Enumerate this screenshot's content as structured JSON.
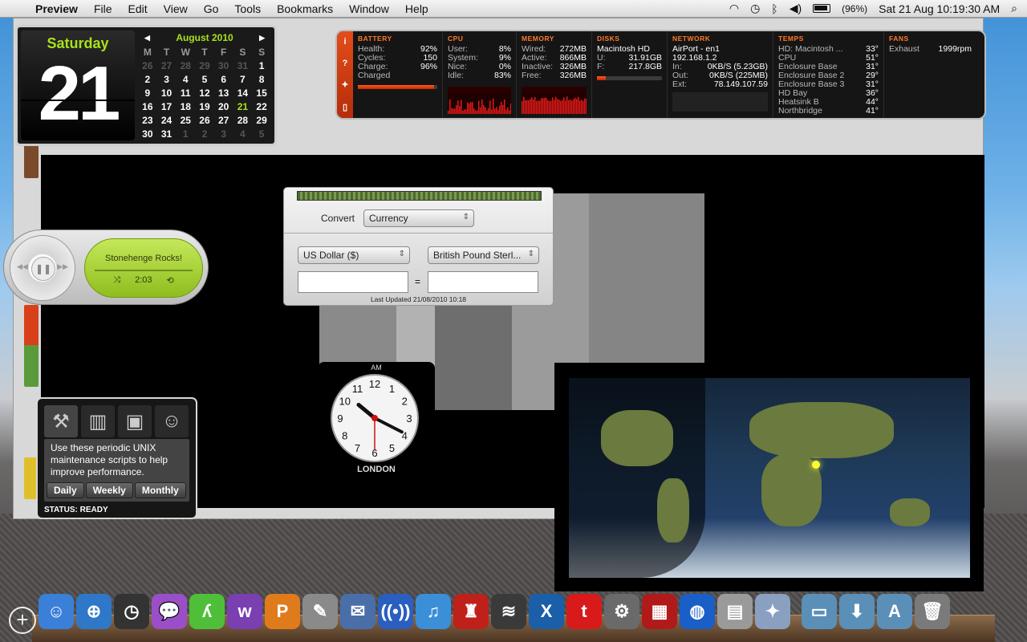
{
  "menubar": {
    "app_name": "Preview",
    "menus": [
      "File",
      "Edit",
      "View",
      "Go",
      "Tools",
      "Bookmarks",
      "Window",
      "Help"
    ],
    "battery_percent": "(96%)",
    "clock": "Sat 21 Aug  10:19:30 AM"
  },
  "calendar": {
    "weekday": "Saturday",
    "day": "21",
    "month_year": "August 2010",
    "weekday_headers": [
      "M",
      "T",
      "W",
      "T",
      "F",
      "S",
      "S"
    ],
    "weeks": [
      [
        "26",
        "27",
        "28",
        "29",
        "30",
        "31",
        "1"
      ],
      [
        "2",
        "3",
        "4",
        "5",
        "6",
        "7",
        "8"
      ],
      [
        "9",
        "10",
        "11",
        "12",
        "13",
        "14",
        "15"
      ],
      [
        "16",
        "17",
        "18",
        "19",
        "20",
        "21",
        "22"
      ],
      [
        "23",
        "24",
        "25",
        "26",
        "27",
        "28",
        "29"
      ],
      [
        "30",
        "31",
        "1",
        "2",
        "3",
        "4",
        "5"
      ]
    ]
  },
  "istat": {
    "battery": {
      "title": "BATTERY",
      "rows": [
        [
          "Health:",
          "92%"
        ],
        [
          "Cycles:",
          "150"
        ],
        [
          "Charge:",
          "96%"
        ],
        [
          "Charged",
          ""
        ]
      ],
      "charge_fraction": 0.96
    },
    "cpu": {
      "title": "CPU",
      "rows": [
        [
          "User:",
          "8%"
        ],
        [
          "System:",
          "9%"
        ],
        [
          "Nice:",
          "0%"
        ],
        [
          "Idle:",
          "83%"
        ]
      ]
    },
    "memory": {
      "title": "MEMORY",
      "rows": [
        [
          "Wired:",
          "272MB"
        ],
        [
          "Active:",
          "866MB"
        ],
        [
          "Inactive:",
          "326MB"
        ],
        [
          "Free:",
          "326MB"
        ]
      ]
    },
    "disks": {
      "title": "DISKS",
      "name": "Macintosh HD",
      "rows": [
        [
          "U:",
          "31.91GB"
        ],
        [
          "F:",
          "217.8GB"
        ]
      ],
      "used_fraction": 0.13
    },
    "network": {
      "title": "NETWORK",
      "iface": "AirPort - en1",
      "ip": "192.168.1.2",
      "rows": [
        [
          "In:",
          "0KB/S (5.23GB)"
        ],
        [
          "Out:",
          "0KB/S (225MB)"
        ],
        [
          "Ext:",
          "78.149.107.59"
        ]
      ]
    },
    "temps": {
      "title": "TEMPS",
      "rows": [
        [
          "HD: Macintosh ...",
          "33°"
        ],
        [
          "CPU",
          "51°"
        ],
        [
          "Enclosure Base",
          "31°"
        ],
        [
          "Enclosure Base 2",
          "29°"
        ],
        [
          "Enclosure Base 3",
          "31°"
        ],
        [
          "HD Bay",
          "36°"
        ],
        [
          "Heatsink B",
          "44°"
        ],
        [
          "Northbridge",
          "41°"
        ]
      ]
    },
    "fans": {
      "title": "FANS",
      "rows": [
        [
          "Exhaust",
          "1999rpm"
        ]
      ]
    }
  },
  "itunes": {
    "song": "Stonehenge Rocks!",
    "time": "2:03"
  },
  "currency": {
    "convert_label": "Convert",
    "category": "Currency",
    "from": "US Dollar ($)",
    "to": "British Pound Sterl...",
    "from_value": "",
    "to_value": "",
    "equals": "=",
    "updated": "Last Updated 21/08/2010 10:18"
  },
  "clock": {
    "ampm": "AM",
    "city": "LONDON",
    "numbers": [
      "12",
      "1",
      "2",
      "3",
      "4",
      "5",
      "6",
      "7",
      "8",
      "9",
      "10",
      "11"
    ],
    "hour": 10,
    "minute": 19,
    "second": 30
  },
  "maintenance": {
    "description": "Use these periodic UNIX maintenance scripts to help improve performance.",
    "buttons": [
      "Daily",
      "Weekly",
      "Monthly"
    ],
    "status": "STATUS: READY"
  },
  "dock": {
    "apps": [
      {
        "name": "finder",
        "glyph": "☺",
        "color": "#3a7fd8"
      },
      {
        "name": "safari",
        "glyph": "⊕",
        "color": "#2f78c9"
      },
      {
        "name": "dashboard",
        "glyph": "◷",
        "color": "#333333"
      },
      {
        "name": "ichat",
        "glyph": "💬",
        "color": "#9a4fc9"
      },
      {
        "name": "adium",
        "glyph": "ʎ",
        "color": "#4fbf3a"
      },
      {
        "name": "wordpress",
        "glyph": "w",
        "color": "#7a3fb0"
      },
      {
        "name": "pages",
        "glyph": "P",
        "color": "#e07b1c"
      },
      {
        "name": "preview",
        "glyph": "✎",
        "color": "#8a8a8a"
      },
      {
        "name": "mail",
        "glyph": "✉",
        "color": "#4a6fa8"
      },
      {
        "name": "radio",
        "glyph": "((•))",
        "color": "#2a5fbf"
      },
      {
        "name": "itunes",
        "glyph": "♫",
        "color": "#3a8fd8"
      },
      {
        "name": "stamp",
        "glyph": "♜",
        "color": "#c0201a"
      },
      {
        "name": "spotify",
        "glyph": "≋",
        "color": "#3a3a3a"
      },
      {
        "name": "xcode",
        "glyph": "X",
        "color": "#1a5fa8"
      },
      {
        "name": "twitterrific",
        "glyph": "t",
        "color": "#d81a1a"
      },
      {
        "name": "system-preferences",
        "glyph": "⚙",
        "color": "#6a6a6a"
      },
      {
        "name": "photo-booth",
        "glyph": "▦",
        "color": "#b01a1a"
      },
      {
        "name": "google-earth",
        "glyph": "◍",
        "color": "#1a5fc8"
      },
      {
        "name": "calculator",
        "glyph": "▤",
        "color": "#9a9a9a"
      },
      {
        "name": "iphoto",
        "glyph": "✦",
        "color": "#8aa0c0"
      },
      {
        "name": "documents-stack",
        "glyph": "▭",
        "color": "#5a8fb8"
      },
      {
        "name": "downloads-stack",
        "glyph": "⬇",
        "color": "#5a8fb8"
      },
      {
        "name": "applications-stack",
        "glyph": "A",
        "color": "#5a8fb8"
      },
      {
        "name": "trash",
        "glyph": "🗑",
        "color": "#7a7a7a"
      }
    ]
  }
}
